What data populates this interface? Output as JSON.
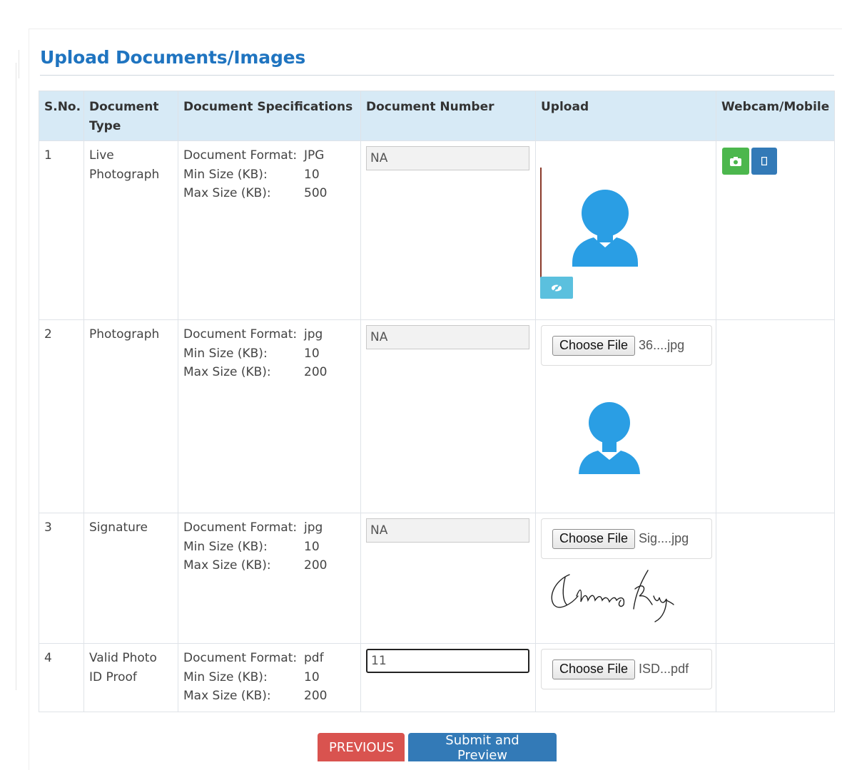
{
  "title": "Upload Documents/Images",
  "table": {
    "headers": [
      "S.No.",
      "Document Type",
      "Document Specifications",
      "Document Number",
      "Upload",
      "Webcam/Mobile"
    ],
    "spec_labels": {
      "format": "Document Format:",
      "min": "Min Size (KB):",
      "max": "Max Size (KB):"
    },
    "rows": [
      {
        "sno": "1",
        "type": "Live Photograph",
        "format": "JPG",
        "min": "10",
        "max": "500",
        "doc_number": "NA"
      },
      {
        "sno": "2",
        "type": "Photograph",
        "format": "jpg",
        "min": "10",
        "max": "200",
        "doc_number": "NA",
        "file_name": "36....jpg"
      },
      {
        "sno": "3",
        "type": "Signature",
        "format": "jpg",
        "min": "10",
        "max": "200",
        "doc_number": "NA",
        "file_name": "Sig....jpg"
      },
      {
        "sno": "4",
        "type": "Valid Photo ID Proof",
        "format": "pdf",
        "min": "10",
        "max": "200",
        "doc_number": "11",
        "file_name": "ISD...pdf"
      }
    ],
    "choose_file_label": "Choose File"
  },
  "buttons": {
    "previous": "PREVIOUS",
    "submit": "Submit and Preview"
  },
  "colors": {
    "title": "#1f74c0",
    "header_bg": "#d7eaf6",
    "webcam_button": "#4cb74d",
    "mobile_button": "#337ab7",
    "view_button": "#5bc0de",
    "previous_button": "#d9534f",
    "submit_button": "#337ab7",
    "avatar": "#2a9ee4"
  },
  "icons": [
    "camera-icon",
    "mobile-icon",
    "eye-slash-icon",
    "avatar-silhouette-icon",
    "signature-image"
  ]
}
